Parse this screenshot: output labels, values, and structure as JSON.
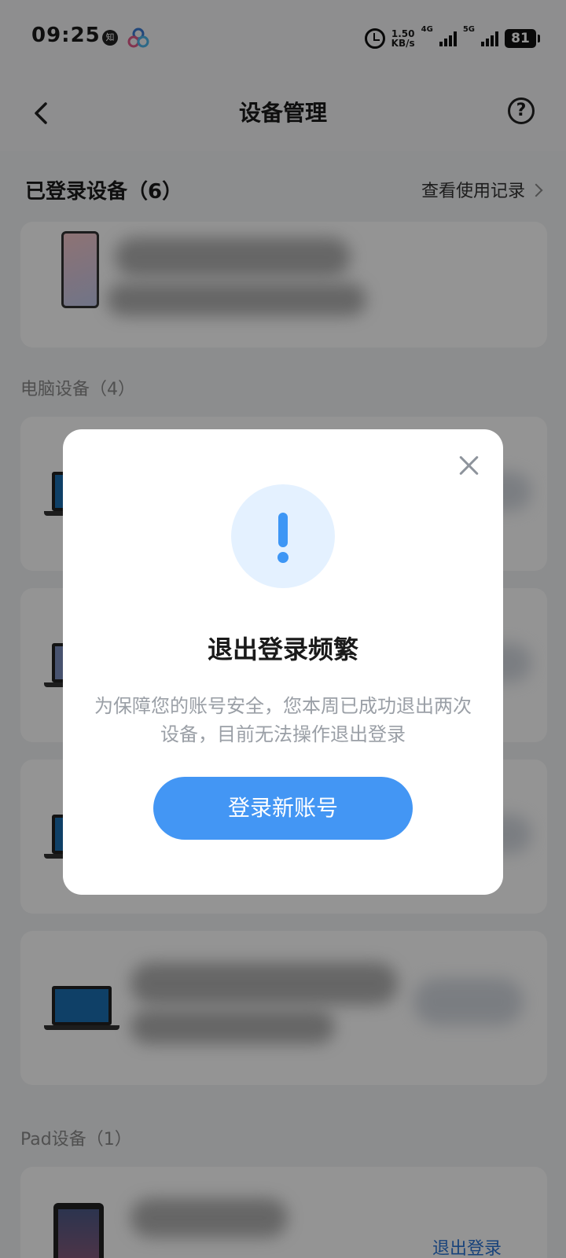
{
  "status_bar": {
    "time": "09:25",
    "zhihu_badge": "知",
    "net_speed_value": "1.50",
    "net_speed_unit": "KB/s",
    "network_1": "4G",
    "network_2": "5G",
    "battery": "81",
    "icons": [
      "alarm-icon",
      "signal-icon",
      "battery-icon"
    ]
  },
  "header": {
    "title": "设备管理",
    "back_icon": "chevron-left-icon",
    "help_icon": "help-circle-icon",
    "help_glyph": "?"
  },
  "logged_in": {
    "title": "已登录设备（6）",
    "history_link": "查看使用记录"
  },
  "groups": {
    "computer_label": "电脑设备（4）",
    "pad_label": "Pad设备（1）",
    "pad_logout": "退出登录"
  },
  "dialog": {
    "title": "退出登录频繁",
    "message": "为保障您的账号安全，您本周已成功退出两次设备，目前无法操作退出登录",
    "primary_button": "登录新账号",
    "close_icon": "close-icon",
    "alert_icon": "exclamation-icon"
  },
  "colors": {
    "accent": "#4396f4",
    "alert_bg": "#e4f1ff",
    "link": "#2b74d4"
  }
}
